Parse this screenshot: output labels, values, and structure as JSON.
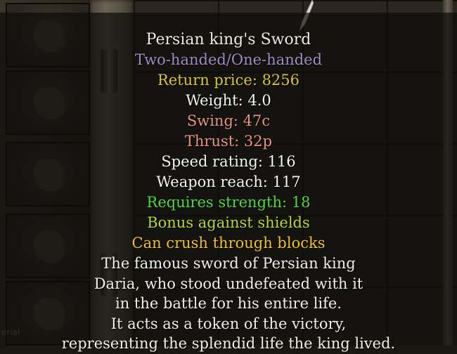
{
  "colors": {
    "name": "#ecebe4",
    "type": "#9b8ec4",
    "price": "#d7c63c",
    "stat": "#f4f4f0",
    "damage": "#e7947c",
    "requirement": "#52d83c",
    "bonus": "#b6d834",
    "special": "#f0c22a",
    "description": "#f0efe8"
  },
  "tooltip": {
    "item_name": "Persian king's Sword",
    "item_type": "Two-handed/One-handed",
    "return_price": "Return price: 8256",
    "weight": "Weight: 4.0",
    "swing": "Swing: 47c",
    "thrust": "Thrust: 32p",
    "speed_rating": "Speed rating: 116",
    "weapon_reach": "Weapon reach: 117",
    "requirement": "Requires strength: 18",
    "bonus": "Bonus against shields",
    "special": "Can crush through blocks",
    "description": [
      "The famous sword of Persian king",
      "Daria, who stood undefeated with it",
      "in the battle for his entire life.",
      "It acts as a token of the victory,",
      "representing the splendid life the king lived."
    ]
  },
  "background": {
    "corner_label": "erial"
  }
}
